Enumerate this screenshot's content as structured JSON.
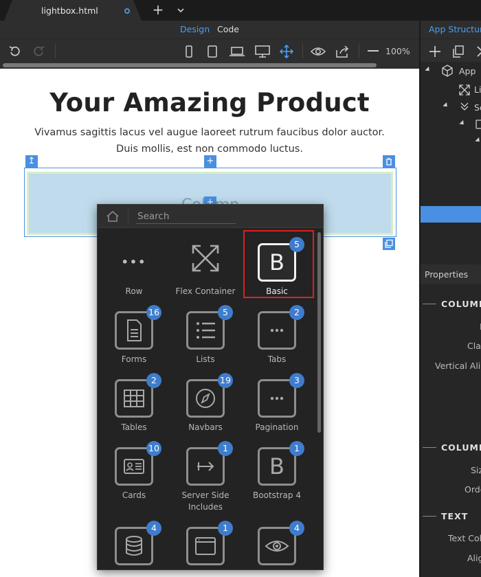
{
  "tab": {
    "title": "lightbox.html",
    "add": "+"
  },
  "view": {
    "design": "Design",
    "code": "Code"
  },
  "toolbar": {
    "zoom": "100%"
  },
  "page": {
    "headline": "Your Amazing Product",
    "lead_line1": "Vivamus sagittis lacus vel augue laoreet rutrum faucibus dolor auctor.",
    "lead_line2": "Duis mollis, est non commodo luctus.",
    "column_label": "Column"
  },
  "picker": {
    "search_placeholder": "Search",
    "items": [
      {
        "label": "Row",
        "icon": "dots-icon",
        "badge": ""
      },
      {
        "label": "Flex Container",
        "icon": "expand-arrows-icon",
        "badge": ""
      },
      {
        "label": "Basic",
        "icon": "bootstrap-b-icon",
        "badge": "5"
      },
      {
        "label": "Forms",
        "icon": "document-icon",
        "badge": "16"
      },
      {
        "label": "Lists",
        "icon": "list-icon",
        "badge": "5"
      },
      {
        "label": "Tabs",
        "icon": "dots-icon",
        "badge": "2"
      },
      {
        "label": "Tables",
        "icon": "table-icon",
        "badge": "2"
      },
      {
        "label": "Navbars",
        "icon": "compass-icon",
        "badge": "19"
      },
      {
        "label": "Pagination",
        "icon": "dots-icon",
        "badge": "3"
      },
      {
        "label": "Cards",
        "icon": "card-icon",
        "badge": "10"
      },
      {
        "label": "Server Side Includes",
        "icon": "arrow-right-icon",
        "badge": "1"
      },
      {
        "label": "Bootstrap 4",
        "icon": "bootstrap-b-icon",
        "badge": "1"
      },
      {
        "label": "",
        "icon": "database-icon",
        "badge": "4"
      },
      {
        "label": "",
        "icon": "window-icon",
        "badge": "1"
      },
      {
        "label": "",
        "icon": "eye-icon",
        "badge": "4"
      }
    ]
  },
  "panel": {
    "title": "App Structure",
    "tree": [
      {
        "label": "App"
      },
      {
        "label": "Li"
      },
      {
        "label": "Se"
      }
    ],
    "properties_title": "Properties",
    "sections": [
      {
        "title": "COLUMN",
        "props": [
          "I",
          "Class",
          "Vertical Align"
        ]
      },
      {
        "title": "COLUMN",
        "props": [
          "Size",
          "Order"
        ]
      },
      {
        "title": "TEXT",
        "props": [
          "Text Color",
          "Align"
        ]
      }
    ]
  },
  "colors": {
    "accent": "#4a90e2",
    "selection": "#e02020",
    "badge": "#3f7ccc"
  }
}
